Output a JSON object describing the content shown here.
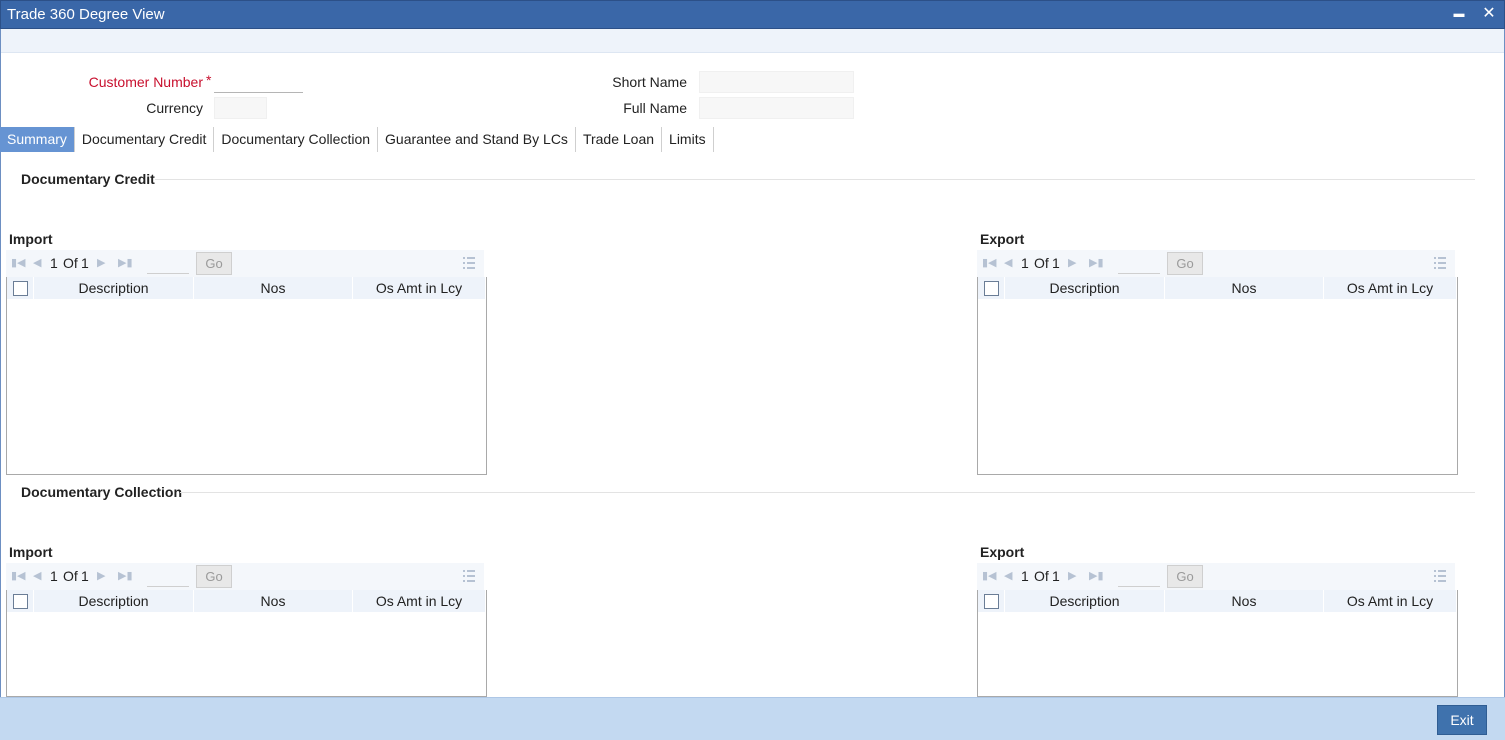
{
  "window": {
    "title": "Trade 360 Degree View",
    "minimize_glyph": "▬",
    "close_glyph": "✕"
  },
  "form": {
    "customer_number_label": "Customer Number",
    "required_mark": "*",
    "customer_number_value": "",
    "currency_label": "Currency",
    "currency_value": "",
    "short_name_label": "Short Name",
    "short_name_value": "",
    "full_name_label": "Full Name",
    "full_name_value": ""
  },
  "tabs": [
    {
      "label": "Summary",
      "active": true
    },
    {
      "label": "Documentary Credit",
      "active": false
    },
    {
      "label": "Documentary Collection",
      "active": false
    },
    {
      "label": "Guarantee and Stand By LCs",
      "active": false
    },
    {
      "label": "Trade Loan",
      "active": false
    },
    {
      "label": "Limits",
      "active": false
    }
  ],
  "sections": {
    "documentary_credit": {
      "title": "Documentary Credit",
      "import": {
        "title": "Import",
        "page_current": "1",
        "page_of": "Of",
        "page_total": "1",
        "go_label": "Go",
        "page_input": "",
        "columns": [
          "Description",
          "Nos",
          "Os Amt in Lcy"
        ]
      },
      "export": {
        "title": "Export",
        "page_current": "1",
        "page_of": "Of",
        "page_total": "1",
        "go_label": "Go",
        "page_input": "",
        "columns": [
          "Description",
          "Nos",
          "Os Amt in Lcy"
        ]
      }
    },
    "documentary_collection": {
      "title": "Documentary Collection",
      "import": {
        "title": "Import",
        "page_current": "1",
        "page_of": "Of",
        "page_total": "1",
        "go_label": "Go",
        "page_input": "",
        "columns": [
          "Description",
          "Nos",
          "Os Amt in Lcy"
        ]
      },
      "export": {
        "title": "Export",
        "page_current": "1",
        "page_of": "Of",
        "page_total": "1",
        "go_label": "Go",
        "page_input": "",
        "columns": [
          "Description",
          "Nos",
          "Os Amt in Lcy"
        ]
      }
    }
  },
  "pager_icons": {
    "first": "first-page-icon",
    "prev": "previous-page-icon",
    "next": "next-page-icon",
    "last": "last-page-icon",
    "columns": "column-settings-icon"
  },
  "footer": {
    "exit_label": "Exit"
  },
  "colors": {
    "titlebar": "#3a67a8",
    "active_tab": "#6694d3",
    "required": "#c8102e",
    "footer": "#c3d9f1",
    "exit_button": "#3f72ad"
  }
}
